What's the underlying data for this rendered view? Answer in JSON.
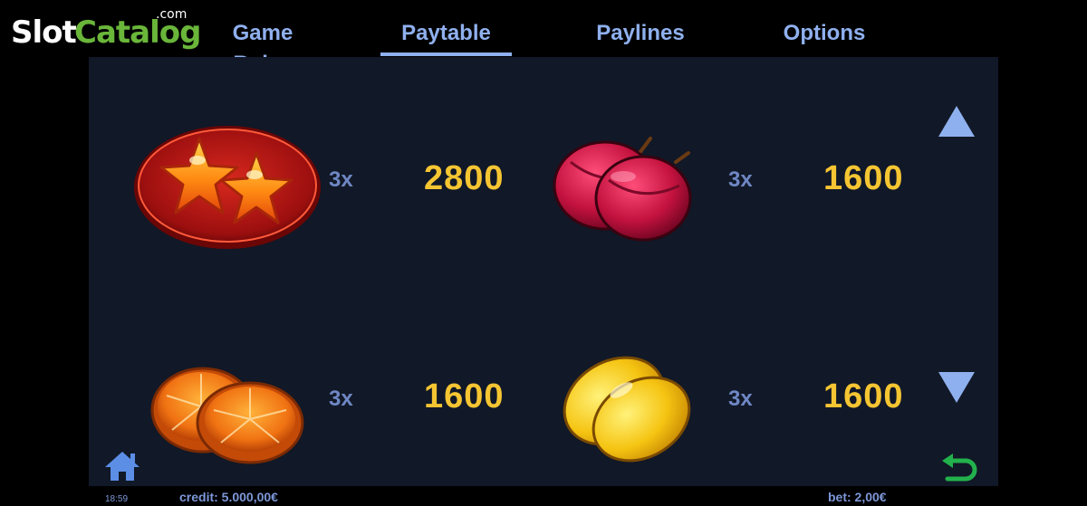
{
  "logo": {
    "part1": "Slot",
    "part2": "Catalog",
    "part3": ".com"
  },
  "tabs": [
    {
      "label": "Game Rules",
      "active": false
    },
    {
      "label": "Paytable",
      "active": true
    },
    {
      "label": "Paylines",
      "active": false
    },
    {
      "label": "Options",
      "active": false
    }
  ],
  "paytable": [
    {
      "symbol": "stars-symbol",
      "multiplier": "3x",
      "payout": "2800"
    },
    {
      "symbol": "plums-symbol",
      "multiplier": "3x",
      "payout": "1600"
    },
    {
      "symbol": "oranges-symbol",
      "multiplier": "3x",
      "payout": "1600"
    },
    {
      "symbol": "lemons-symbol",
      "multiplier": "3x",
      "payout": "1600"
    }
  ],
  "status": {
    "time": "18:59",
    "credit": "credit: 5.000,00€",
    "bet": "bet: 2,00€"
  },
  "colors": {
    "accent": "#8fb0ee",
    "payout": "#f5c532",
    "panel": "#111827",
    "back": "#22b14c"
  }
}
